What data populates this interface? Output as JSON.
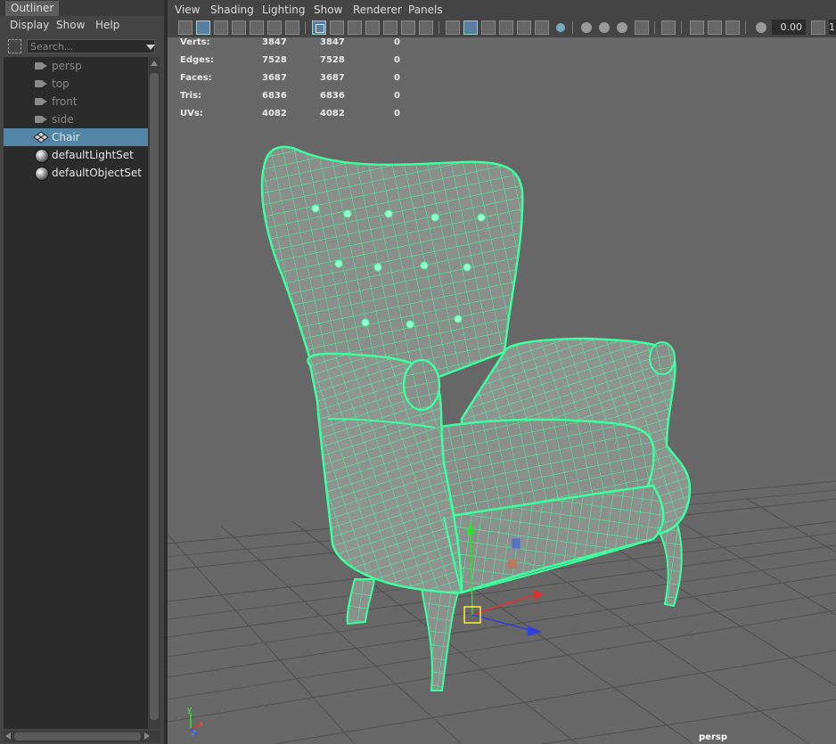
{
  "outliner": {
    "tab": "Outliner",
    "menu": [
      "Display",
      "Show",
      "Help"
    ],
    "search_placeholder": "Search...",
    "items": [
      {
        "label": "persp",
        "type": "camera"
      },
      {
        "label": "top",
        "type": "camera"
      },
      {
        "label": "front",
        "type": "camera"
      },
      {
        "label": "side",
        "type": "camera"
      },
      {
        "label": "Chair",
        "type": "mesh",
        "selected": true
      },
      {
        "label": "defaultLightSet",
        "type": "set"
      },
      {
        "label": "defaultObjectSet",
        "type": "set"
      }
    ]
  },
  "viewport": {
    "menu": [
      "View",
      "Shading",
      "Lighting",
      "Show",
      "Renderer",
      "Panels"
    ],
    "exposure_value": "0.00",
    "gamma_value": "1",
    "camera_label": "persp",
    "hud": [
      {
        "label": "Verts:",
        "a": "3847",
        "b": "3847",
        "c": "0"
      },
      {
        "label": "Edges:",
        "a": "7528",
        "b": "7528",
        "c": "0"
      },
      {
        "label": "Faces:",
        "a": "3687",
        "b": "3687",
        "c": "0"
      },
      {
        "label": "Tris:",
        "a": "6836",
        "b": "6836",
        "c": "0"
      },
      {
        "label": "UVs:",
        "a": "4082",
        "b": "4082",
        "c": "0"
      }
    ],
    "axis_labels": {
      "x": "x",
      "y": "y",
      "z": "z"
    }
  },
  "colors": {
    "panel_bg": "#444444",
    "tree_bg": "#2b2b2b",
    "selection": "#5285a6",
    "viewport_bg": "#676767",
    "wireframe": "#3dff9e",
    "mesh_fill": "#8a8f8c"
  }
}
